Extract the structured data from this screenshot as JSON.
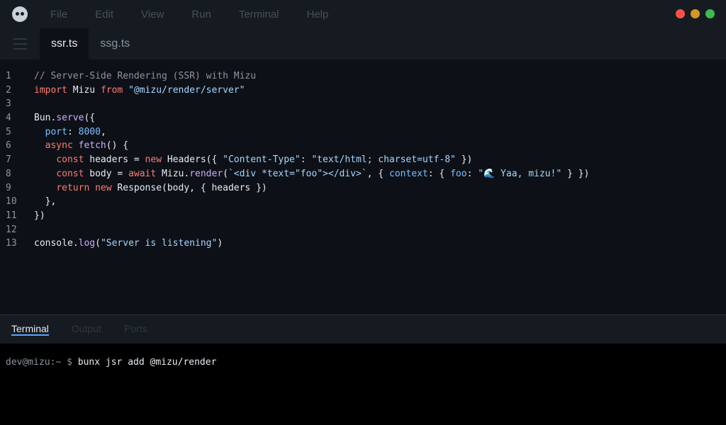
{
  "colors": {
    "close": "#f85149",
    "minimize": "#d29922",
    "maximize": "#3fb950",
    "accent": "#58a6ff"
  },
  "titlebar": {
    "logo_icon": "cat-face-logo",
    "menu": [
      "File",
      "Edit",
      "View",
      "Run",
      "Terminal",
      "Help"
    ]
  },
  "tabs": {
    "menu_icon": "hamburger-icon",
    "items": [
      {
        "label": "ssr.ts",
        "active": true
      },
      {
        "label": "ssg.ts",
        "active": false
      }
    ]
  },
  "editor": {
    "lines": [
      {
        "num": "1",
        "tokens": [
          {
            "t": "// Server-Side Rendering (SSR) with Mizu",
            "c": "comment"
          }
        ]
      },
      {
        "num": "2",
        "tokens": [
          {
            "t": "import",
            "c": "keyword"
          },
          {
            "t": " Mizu ",
            "c": "plain"
          },
          {
            "t": "from",
            "c": "keyword"
          },
          {
            "t": " \"@mizu/render/server\"",
            "c": "string"
          }
        ]
      },
      {
        "num": "3",
        "tokens": []
      },
      {
        "num": "4",
        "tokens": [
          {
            "t": "Bun.",
            "c": "plain"
          },
          {
            "t": "serve",
            "c": "func"
          },
          {
            "t": "({",
            "c": "plain"
          }
        ]
      },
      {
        "num": "5",
        "tokens": [
          {
            "t": "  ",
            "c": "plain"
          },
          {
            "t": "port",
            "c": "prop"
          },
          {
            "t": ": ",
            "c": "plain"
          },
          {
            "t": "8000",
            "c": "number"
          },
          {
            "t": ",",
            "c": "plain"
          }
        ]
      },
      {
        "num": "6",
        "tokens": [
          {
            "t": "  ",
            "c": "plain"
          },
          {
            "t": "async",
            "c": "keyword"
          },
          {
            "t": " ",
            "c": "plain"
          },
          {
            "t": "fetch",
            "c": "func"
          },
          {
            "t": "() {",
            "c": "plain"
          }
        ]
      },
      {
        "num": "7",
        "tokens": [
          {
            "t": "    ",
            "c": "plain"
          },
          {
            "t": "const",
            "c": "keyword"
          },
          {
            "t": " headers = ",
            "c": "plain"
          },
          {
            "t": "new",
            "c": "keyword"
          },
          {
            "t": " Headers({ ",
            "c": "plain"
          },
          {
            "t": "\"Content-Type\"",
            "c": "string"
          },
          {
            "t": ": ",
            "c": "plain"
          },
          {
            "t": "\"text/html; charset=utf-8\"",
            "c": "string"
          },
          {
            "t": " })",
            "c": "plain"
          }
        ]
      },
      {
        "num": "8",
        "tokens": [
          {
            "t": "    ",
            "c": "plain"
          },
          {
            "t": "const",
            "c": "keyword"
          },
          {
            "t": " body = ",
            "c": "plain"
          },
          {
            "t": "await",
            "c": "keyword"
          },
          {
            "t": " Mizu.",
            "c": "plain"
          },
          {
            "t": "render",
            "c": "func"
          },
          {
            "t": "(",
            "c": "plain"
          },
          {
            "t": "`<div *text=\"foo\"></div>`",
            "c": "string"
          },
          {
            "t": ", { ",
            "c": "plain"
          },
          {
            "t": "context",
            "c": "prop"
          },
          {
            "t": ": { ",
            "c": "plain"
          },
          {
            "t": "foo",
            "c": "prop"
          },
          {
            "t": ": ",
            "c": "plain"
          },
          {
            "t": "\"🌊 Yaa, mizu!\"",
            "c": "string"
          },
          {
            "t": " } })",
            "c": "plain"
          }
        ]
      },
      {
        "num": "9",
        "tokens": [
          {
            "t": "    ",
            "c": "plain"
          },
          {
            "t": "return",
            "c": "keyword"
          },
          {
            "t": " ",
            "c": "plain"
          },
          {
            "t": "new",
            "c": "keyword"
          },
          {
            "t": " Response(body, { headers })",
            "c": "plain"
          }
        ]
      },
      {
        "num": "10",
        "tokens": [
          {
            "t": "  },",
            "c": "plain"
          }
        ]
      },
      {
        "num": "11",
        "tokens": [
          {
            "t": "})",
            "c": "plain"
          }
        ]
      },
      {
        "num": "12",
        "tokens": []
      },
      {
        "num": "13",
        "tokens": [
          {
            "t": "console.",
            "c": "plain"
          },
          {
            "t": "log",
            "c": "func"
          },
          {
            "t": "(",
            "c": "plain"
          },
          {
            "t": "\"Server is listening\"",
            "c": "string"
          },
          {
            "t": ")",
            "c": "plain"
          }
        ]
      }
    ]
  },
  "panel": {
    "tabs": [
      {
        "label": "Terminal",
        "active": true
      },
      {
        "label": "Output",
        "active": false
      },
      {
        "label": "Ports",
        "active": false
      }
    ]
  },
  "terminal": {
    "prompt": "dev@mizu:~ $ ",
    "command": "bunx jsr add @mizu/render"
  }
}
